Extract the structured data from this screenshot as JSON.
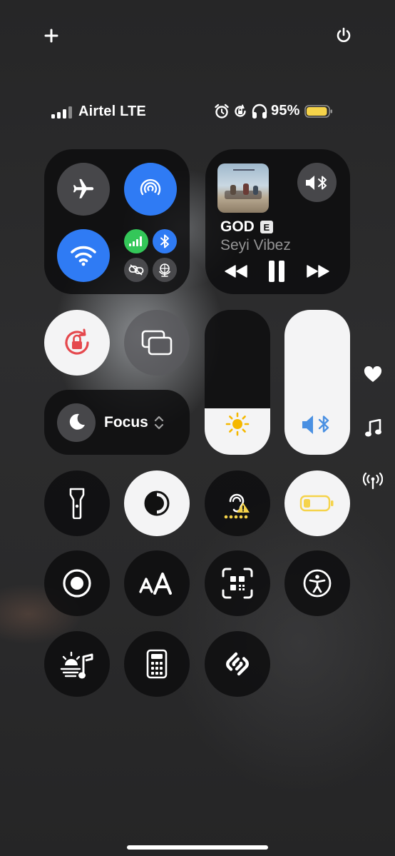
{
  "top": {
    "add_icon": "plus-icon",
    "power_icon": "power-icon"
  },
  "status_bar": {
    "carrier": "Airtel LTE",
    "battery_percent": "95%",
    "battery_level": 0.95,
    "icons": [
      "alarm-icon",
      "orientation-lock-icon",
      "headphones-icon"
    ],
    "battery_color": "#f5d34a"
  },
  "connectivity": {
    "airplane": "airplane-icon",
    "airdrop": "airdrop-icon",
    "wifi": "wifi-icon",
    "cellular": "cellular-icon",
    "bluetooth": "bluetooth-icon",
    "vpn": "link-icon",
    "hotspot": "globe-icon"
  },
  "now_playing": {
    "title": "GOD",
    "explicit": "E",
    "artist": "Seyi Vibez",
    "output_icon": "speaker-bluetooth-icon"
  },
  "focus": {
    "label": "Focus"
  },
  "sliders": {
    "brightness_level": 0.32,
    "volume_level": 1.0
  },
  "side_icons": [
    "heart-icon",
    "music-note-icon",
    "broadcast-icon"
  ],
  "colors": {
    "accent_blue": "#2f7bf4",
    "cell_green": "#34c759",
    "warning_yellow": "#f5d34a",
    "rotation_red": "#e5484d"
  }
}
